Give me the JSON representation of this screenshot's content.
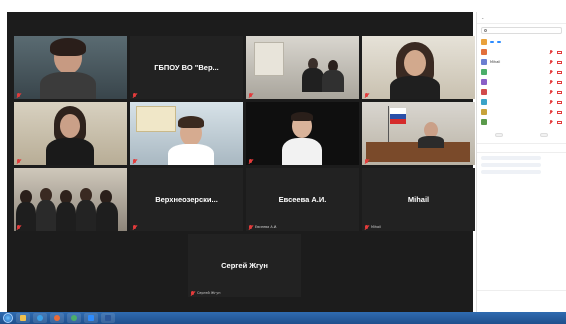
{
  "colors": {
    "accent": "#2d8cff",
    "speaking_border": "#d8c93a",
    "muted_red": "#e23b3b",
    "taskbar": "#2f6bb0"
  },
  "gallery": {
    "tiles": [
      {
        "id": "t1",
        "label": "",
        "caption": "",
        "kind": "video"
      },
      {
        "id": "t2",
        "label": "ГБПОУ ВО \"Вер...",
        "caption": "",
        "kind": "name"
      },
      {
        "id": "t3",
        "label": "",
        "caption": "",
        "kind": "video"
      },
      {
        "id": "t4",
        "label": "",
        "caption": "",
        "kind": "video"
      },
      {
        "id": "t5",
        "label": "",
        "caption": "",
        "kind": "video"
      },
      {
        "id": "t6",
        "label": "",
        "caption": "",
        "kind": "video"
      },
      {
        "id": "t7",
        "label": "",
        "caption": "",
        "kind": "video"
      },
      {
        "id": "t8",
        "label": "",
        "caption": "",
        "kind": "video",
        "speaking": true
      },
      {
        "id": "t9",
        "label": "",
        "caption": "",
        "kind": "video"
      },
      {
        "id": "t10",
        "label": "Верхнеозерски...",
        "caption": "",
        "kind": "name"
      },
      {
        "id": "t11",
        "label": "Евсеева А.И.",
        "caption": "Евсеева А.И.",
        "kind": "name"
      },
      {
        "id": "t12",
        "label": "Mihail",
        "caption": "Mihail",
        "kind": "name"
      },
      {
        "id": "t13",
        "label": "Сергей Жгун",
        "caption": "Сергей Жгун",
        "kind": "name"
      }
    ]
  },
  "participants_panel": {
    "title": "",
    "search_placeholder": "",
    "rows": [
      {
        "name": "",
        "avatar": "#e9a13b",
        "pills": [
          "",
          ""
        ]
      },
      {
        "name": "",
        "avatar": "#e26f3b"
      },
      {
        "name": "Mihail",
        "avatar": "#6b7fd1"
      },
      {
        "name": "",
        "avatar": "#4bae6a"
      },
      {
        "name": "",
        "avatar": "#8a5fc7"
      },
      {
        "name": "",
        "avatar": "#d14b4b"
      },
      {
        "name": "",
        "avatar": "#3ba3c7"
      },
      {
        "name": "",
        "avatar": "#c7a33b"
      },
      {
        "name": "",
        "avatar": "#5a9a4b"
      }
    ],
    "actions": [
      "",
      ""
    ]
  },
  "chat": {
    "title": "",
    "messages": [
      {
        "from": "",
        "text": ""
      },
      {
        "from": "",
        "text": ""
      },
      {
        "from": "",
        "text": ""
      }
    ],
    "to_label": "",
    "to_value": "",
    "input_placeholder": ""
  },
  "taskbar": {
    "apps": [
      {
        "name": "explorer",
        "color": "#f2c14e"
      },
      {
        "name": "ie",
        "color": "#3aa0e8"
      },
      {
        "name": "media",
        "color": "#e86b3a"
      },
      {
        "name": "chrome",
        "color": "#4bae6a"
      },
      {
        "name": "zoom",
        "color": "#2d8cff"
      },
      {
        "name": "word",
        "color": "#2b579a"
      }
    ],
    "tray_text": ""
  }
}
